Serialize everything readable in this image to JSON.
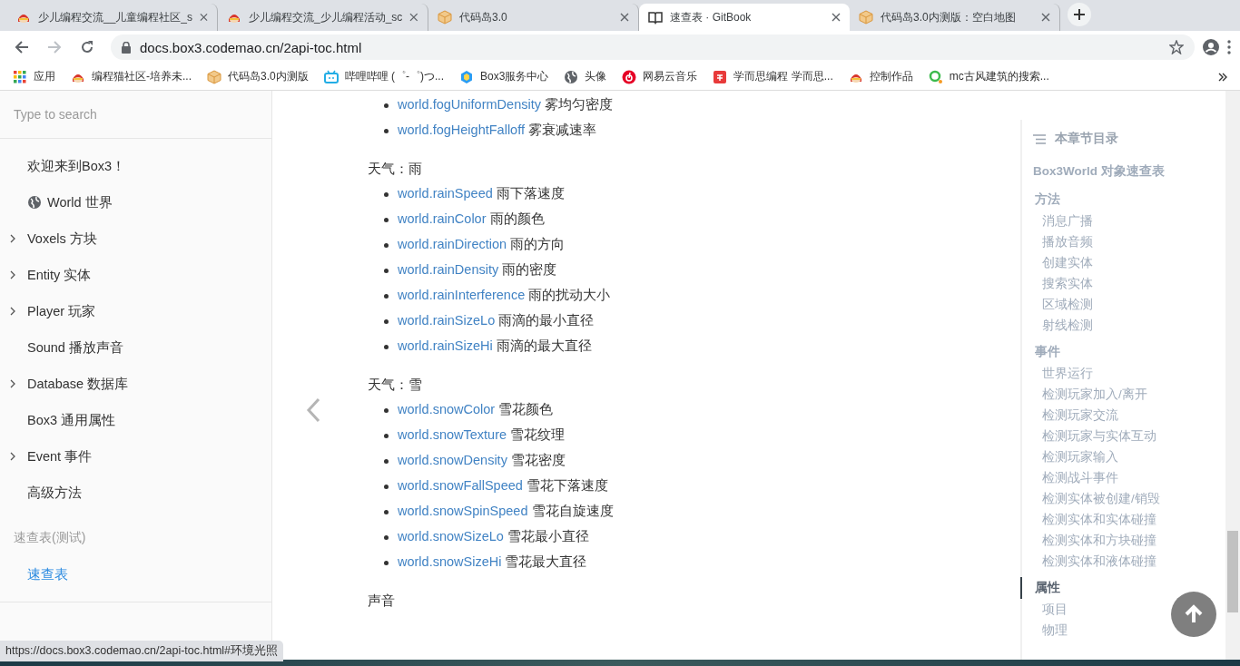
{
  "tabs": [
    {
      "title": "少儿编程交流__儿童编程社区_s",
      "kind": "mascot",
      "selected": false
    },
    {
      "title": "少儿编程交流_少儿编程活动_sc",
      "kind": "mascot",
      "selected": false
    },
    {
      "title": "代码岛3.0",
      "kind": "cube",
      "selected": false
    },
    {
      "title": "速查表 · GitBook",
      "kind": "book",
      "selected": true
    },
    {
      "title": "代码岛3.0内测版：空白地图",
      "kind": "cube",
      "selected": false
    }
  ],
  "address": {
    "url": "docs.box3.codemao.cn/2api-toc.html"
  },
  "bookmarks": [
    {
      "label": "应用",
      "kind": "apps"
    },
    {
      "label": "编程猫社区-培养未...",
      "kind": "mascot"
    },
    {
      "label": "代码岛3.0内测版",
      "kind": "cube"
    },
    {
      "label": "哔哩哔哩 (゜-゜)つ...",
      "kind": "tv"
    },
    {
      "label": "Box3服务中心",
      "kind": "hex"
    },
    {
      "label": "头像",
      "kind": "globe"
    },
    {
      "label": "网易云音乐",
      "kind": "music"
    },
    {
      "label": "学而思编程 学而思...",
      "kind": "square"
    },
    {
      "label": "控制作品",
      "kind": "mascot"
    },
    {
      "label": "mc古风建筑的搜索...",
      "kind": "ring"
    }
  ],
  "sidebar": {
    "search": {
      "placeholder": "Type to search"
    },
    "items": [
      {
        "label": "欢迎来到Box3！",
        "expandable": false
      },
      {
        "label": "World 世界",
        "expandable": false,
        "kind": "globe"
      },
      {
        "label": "Voxels 方块",
        "expandable": true
      },
      {
        "label": "Entity 实体",
        "expandable": true
      },
      {
        "label": "Player 玩家",
        "expandable": true
      },
      {
        "label": "Sound 播放声音",
        "expandable": false
      },
      {
        "label": "Database 数据库",
        "expandable": true
      },
      {
        "label": "Box3 通用属性",
        "expandable": false
      },
      {
        "label": "Event 事件",
        "expandable": true
      },
      {
        "label": "高级方法",
        "expandable": false
      }
    ],
    "section": {
      "title": "速查表(测试)",
      "items": [
        {
          "label": "速查表",
          "selected": true
        }
      ]
    }
  },
  "content": {
    "sections": [
      {
        "items": [
          {
            "code": "world.fogUniformDensity",
            "desc": "雾均匀密度"
          },
          {
            "code": "world.fogHeightFalloff",
            "desc": "雾衰减速率"
          }
        ]
      },
      {
        "heading": "天气：雨",
        "items": [
          {
            "code": "world.rainSpeed",
            "desc": "雨下落速度"
          },
          {
            "code": "world.rainColor",
            "desc": "雨的颜色"
          },
          {
            "code": "world.rainDirection",
            "desc": "雨的方向"
          },
          {
            "code": "world.rainDensity",
            "desc": "雨的密度"
          },
          {
            "code": "world.rainInterference",
            "desc": "雨的扰动大小"
          },
          {
            "code": "world.rainSizeLo",
            "desc": "雨滴的最小直径"
          },
          {
            "code": "world.rainSizeHi",
            "desc": "雨滴的最大直径"
          }
        ]
      },
      {
        "heading": "天气：雪",
        "items": [
          {
            "code": "world.snowColor",
            "desc": "雪花颜色"
          },
          {
            "code": "world.snowTexture",
            "desc": "雪花纹理"
          },
          {
            "code": "world.snowDensity",
            "desc": "雪花密度"
          },
          {
            "code": "world.snowFallSpeed",
            "desc": "雪花下落速度"
          },
          {
            "code": "world.snowSpinSpeed",
            "desc": "雪花自旋速度"
          },
          {
            "code": "world.snowSizeLo",
            "desc": "雪花最小直径"
          },
          {
            "code": "world.snowSizeHi",
            "desc": "雪花最大直径"
          }
        ]
      },
      {
        "heading": "声音"
      }
    ]
  },
  "toc": {
    "title": "本章节目录",
    "root": "Box3World 对象速查表",
    "groups": [
      {
        "label": "方法",
        "selected": false,
        "children": [
          "消息广播",
          "播放音频",
          "创建实体",
          "搜索实体",
          "区域检测",
          "射线检测"
        ]
      },
      {
        "label": "事件",
        "selected": false,
        "children": [
          "世界运行",
          "检测玩家加入/离开",
          "检测玩家交流",
          "检测玩家与实体互动",
          "检测玩家输入",
          "检测战斗事件",
          "检测实体被创建/销毁",
          "检测实体和实体碰撞",
          "检测实体和方块碰撞",
          "检测实体和液体碰撞"
        ]
      },
      {
        "label": "属性",
        "selected": true,
        "children": [
          "项目",
          "物理"
        ]
      }
    ]
  },
  "status_url": "https://docs.box3.codemao.cn/2api-toc.html#环境光照"
}
